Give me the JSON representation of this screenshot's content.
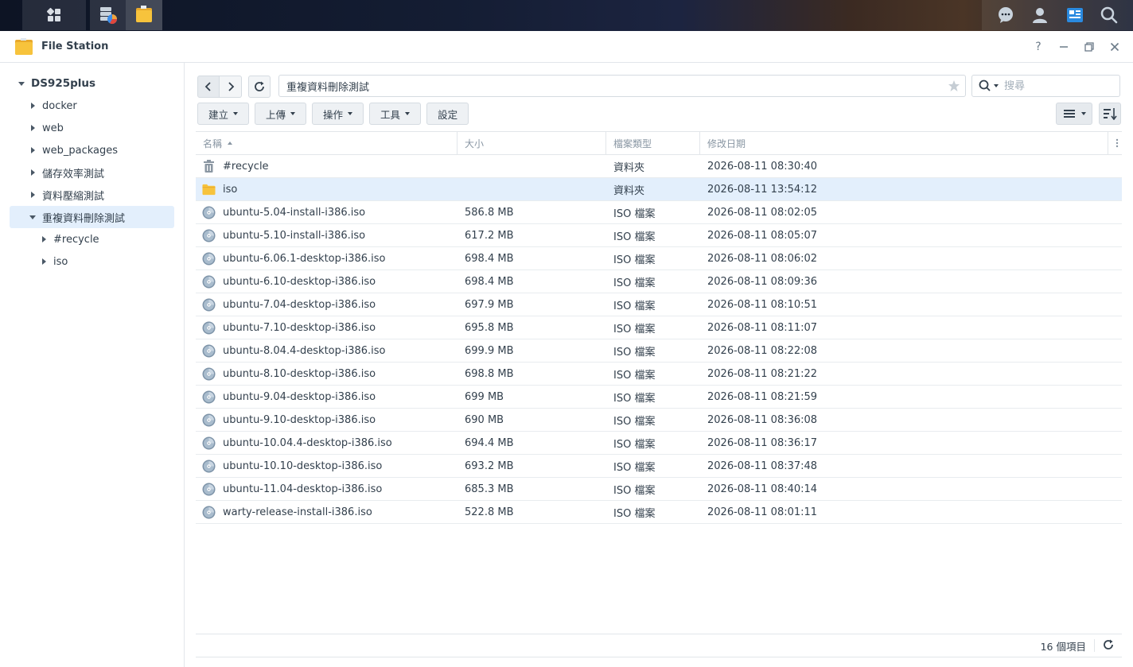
{
  "window": {
    "title": "File Station"
  },
  "colors": {
    "accent": "#0086e5",
    "selected_bg": "#e3effc",
    "folder": "#f7c33c"
  },
  "sidebar": {
    "root": "DS925plus",
    "items": [
      {
        "label": "docker"
      },
      {
        "label": "web"
      },
      {
        "label": "web_packages"
      },
      {
        "label": "儲存效率測試"
      },
      {
        "label": "資料壓縮測試"
      },
      {
        "label": "重複資料刪除測試"
      }
    ],
    "children": [
      {
        "label": "#recycle"
      },
      {
        "label": "iso"
      }
    ]
  },
  "path": {
    "current": "重複資料刪除測試"
  },
  "search": {
    "placeholder": "搜尋"
  },
  "toolbar": {
    "create": "建立",
    "upload": "上傳",
    "action": "操作",
    "tools": "工具",
    "settings": "設定"
  },
  "columns": {
    "name": "名稱",
    "size": "大小",
    "type": "檔案類型",
    "modified": "修改日期"
  },
  "files": [
    {
      "name": "#recycle",
      "size": "",
      "type": "資料夾",
      "modified": "2026-08-11 08:30:40",
      "icon": "trash-icon"
    },
    {
      "name": "iso",
      "size": "",
      "type": "資料夾",
      "modified": "2026-08-11 13:54:12",
      "icon": "folder-icon"
    },
    {
      "name": "ubuntu-5.04-install-i386.iso",
      "size": "586.8 MB",
      "type": "ISO 檔案",
      "modified": "2026-08-11 08:02:05",
      "icon": "disc-icon"
    },
    {
      "name": "ubuntu-5.10-install-i386.iso",
      "size": "617.2 MB",
      "type": "ISO 檔案",
      "modified": "2026-08-11 08:05:07",
      "icon": "disc-icon"
    },
    {
      "name": "ubuntu-6.06.1-desktop-i386.iso",
      "size": "698.4 MB",
      "type": "ISO 檔案",
      "modified": "2026-08-11 08:06:02",
      "icon": "disc-icon"
    },
    {
      "name": "ubuntu-6.10-desktop-i386.iso",
      "size": "698.4 MB",
      "type": "ISO 檔案",
      "modified": "2026-08-11 08:09:36",
      "icon": "disc-icon"
    },
    {
      "name": "ubuntu-7.04-desktop-i386.iso",
      "size": "697.9 MB",
      "type": "ISO 檔案",
      "modified": "2026-08-11 08:10:51",
      "icon": "disc-icon"
    },
    {
      "name": "ubuntu-7.10-desktop-i386.iso",
      "size": "695.8 MB",
      "type": "ISO 檔案",
      "modified": "2026-08-11 08:11:07",
      "icon": "disc-icon"
    },
    {
      "name": "ubuntu-8.04.4-desktop-i386.iso",
      "size": "699.9 MB",
      "type": "ISO 檔案",
      "modified": "2026-08-11 08:22:08",
      "icon": "disc-icon"
    },
    {
      "name": "ubuntu-8.10-desktop-i386.iso",
      "size": "698.8 MB",
      "type": "ISO 檔案",
      "modified": "2026-08-11 08:21:22",
      "icon": "disc-icon"
    },
    {
      "name": "ubuntu-9.04-desktop-i386.iso",
      "size": "699 MB",
      "type": "ISO 檔案",
      "modified": "2026-08-11 08:21:59",
      "icon": "disc-icon"
    },
    {
      "name": "ubuntu-9.10-desktop-i386.iso",
      "size": "690 MB",
      "type": "ISO 檔案",
      "modified": "2026-08-11 08:36:08",
      "icon": "disc-icon"
    },
    {
      "name": "ubuntu-10.04.4-desktop-i386.iso",
      "size": "694.4 MB",
      "type": "ISO 檔案",
      "modified": "2026-08-11 08:36:17",
      "icon": "disc-icon"
    },
    {
      "name": "ubuntu-10.10-desktop-i386.iso",
      "size": "693.2 MB",
      "type": "ISO 檔案",
      "modified": "2026-08-11 08:37:48",
      "icon": "disc-icon"
    },
    {
      "name": "ubuntu-11.04-desktop-i386.iso",
      "size": "685.3 MB",
      "type": "ISO 檔案",
      "modified": "2026-08-11 08:40:14",
      "icon": "disc-icon"
    },
    {
      "name": "warty-release-install-i386.iso",
      "size": "522.8 MB",
      "type": "ISO 檔案",
      "modified": "2026-08-11 08:01:11",
      "icon": "disc-icon"
    }
  ],
  "status": {
    "count": "16 個項目"
  }
}
